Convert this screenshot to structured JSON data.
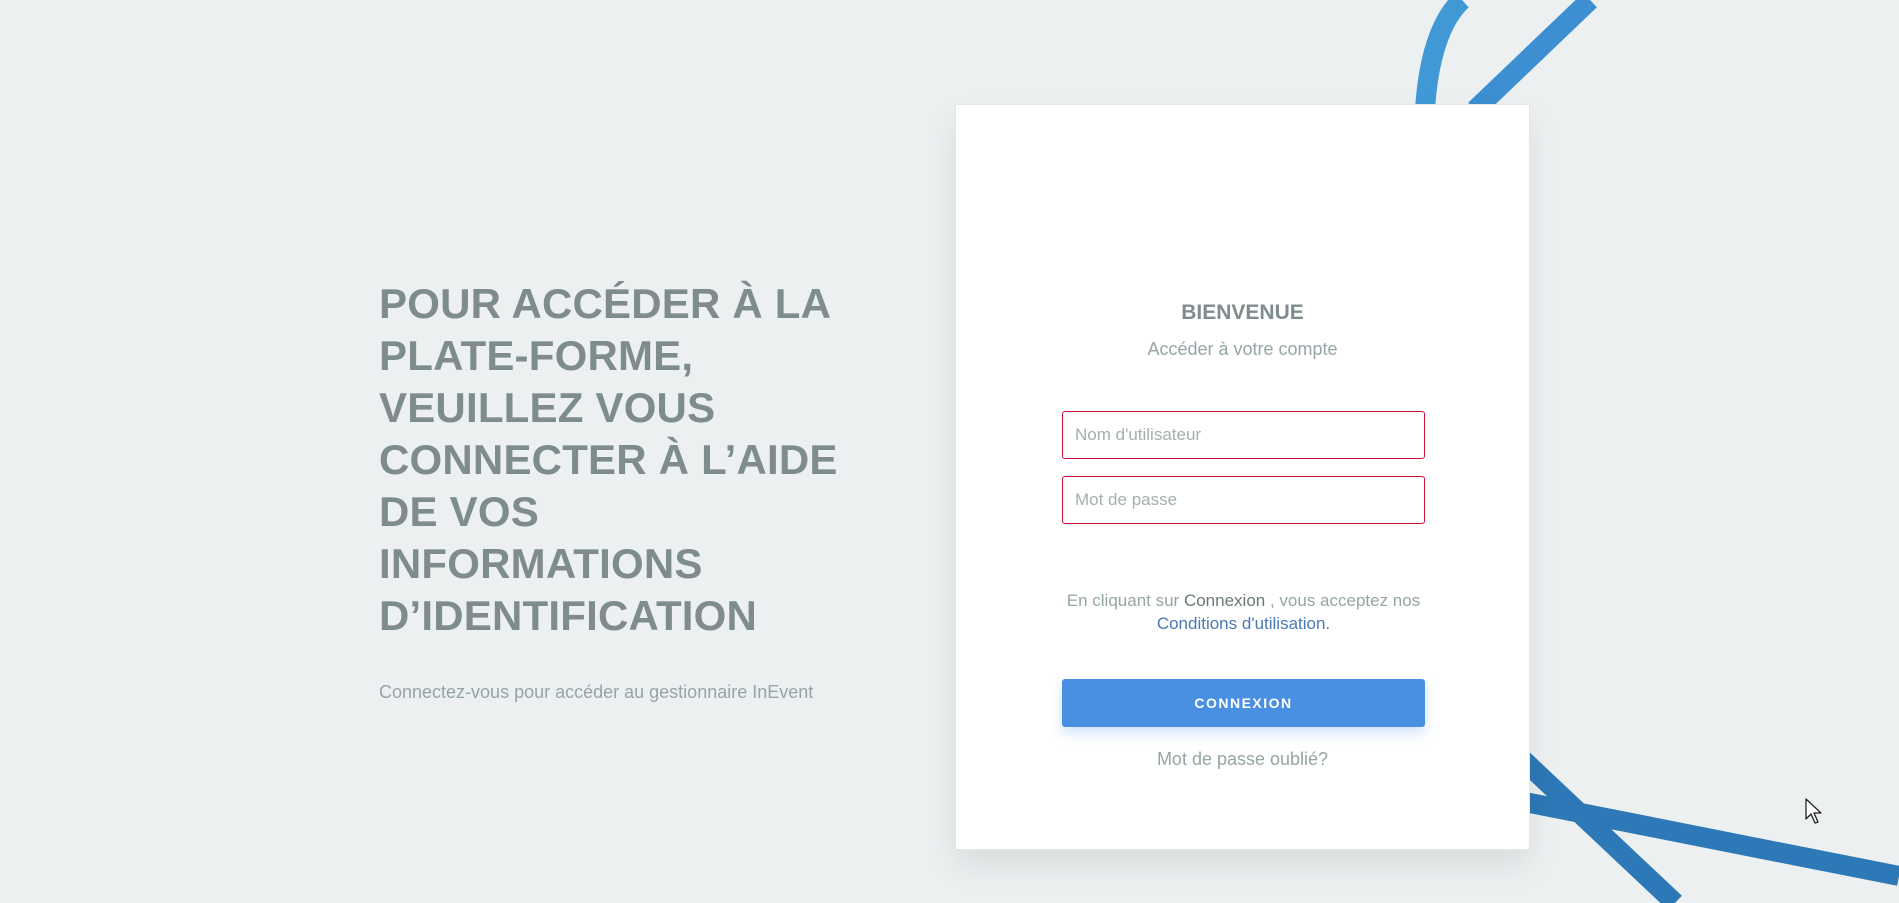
{
  "left": {
    "headline": "POUR ACCÉDER À LA PLATE-FORME, VEUILLEZ VOUS CONNECTER À L’AIDE DE VOS INFORMATIONS D’IDENTIFICATION",
    "subtitle": "Connectez-vous pour accéder au gestionnaire InEvent"
  },
  "card": {
    "title": "BIENVENUE",
    "subtitle": "Accéder à votre compte",
    "username_placeholder": "Nom d'utilisateur",
    "password_placeholder": "Mot de passe",
    "terms_prefix": "En cliquant sur",
    "terms_strong": "Connexion",
    "terms_suffix": ", vous acceptez nos",
    "terms_link": "Conditions d'utilisation.",
    "submit_label": "CONNEXION",
    "forgot_label": "Mot de passe oublié?"
  },
  "colors": {
    "background": "#ecf0f1",
    "accent": "#4a90e2",
    "error_border": "#d0103a",
    "decor_line": "#3d8fd1"
  },
  "icons": [
    "mouse-cursor-icon"
  ]
}
